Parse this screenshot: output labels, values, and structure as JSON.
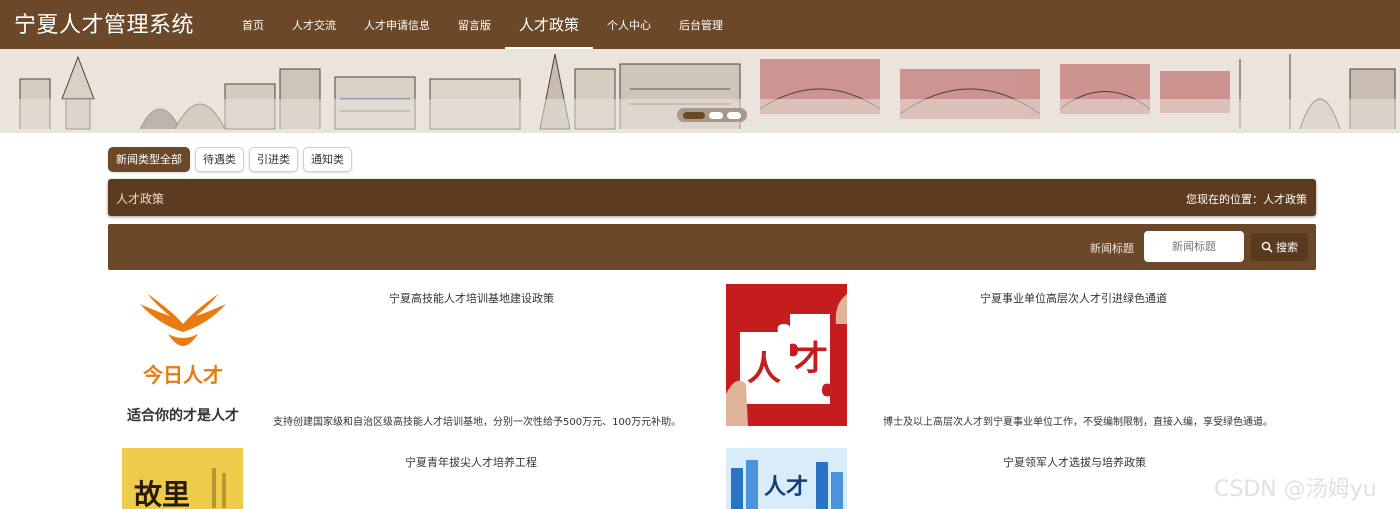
{
  "header": {
    "brand": "宁夏人才管理系统",
    "nav": [
      "首页",
      "人才交流",
      "人才申请信息",
      "留言版",
      "人才政策",
      "个人中心",
      "后台管理"
    ],
    "active_nav": "人才政策"
  },
  "categories": [
    "新闻类型全部",
    "待遇类",
    "引进类",
    "通知类"
  ],
  "titlebar": {
    "title": "人才政策",
    "location": "您现在的位置：人才政策"
  },
  "search": {
    "label": "新闻标题",
    "placeholder": "新闻标题",
    "button": "搜索"
  },
  "news": [
    {
      "title": "宁夏高技能人才培训基地建设政策",
      "desc": "支持创建国家级和自治区级高技能人才培训基地，分别一次性给予500万元、100万元补助。",
      "logo_text": "今日人才",
      "slogan": "适合你的才是人才"
    },
    {
      "title": "宁夏事业单位高层次人才引进绿色通道",
      "desc": "博士及以上高层次人才到宁夏事业单位工作，不受编制限制，直接入编，享受绿色通道。",
      "puzzle_chars": [
        "人",
        "才"
      ]
    },
    {
      "title": "宁夏青年拔尖人才培养工程",
      "thumb_text": "故里"
    },
    {
      "title": "宁夏领军人才选拔与培养政策",
      "thumb_text": "人才"
    }
  ],
  "watermark": "CSDN @汤姆yu",
  "colors": {
    "brown": "#6b4827",
    "dark_brown": "#5c3b1f",
    "orange": "#e87b12"
  }
}
